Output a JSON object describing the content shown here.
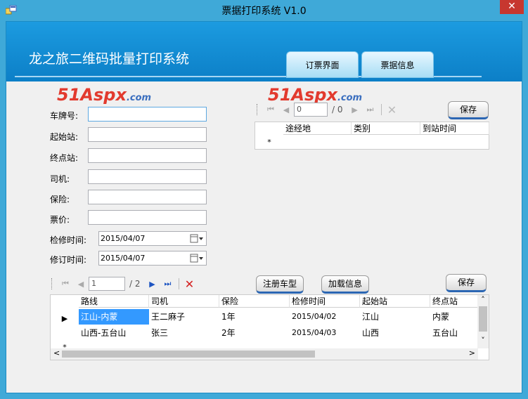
{
  "window": {
    "title": "票据打印系统 V1.0",
    "close_label": "✕"
  },
  "banner": {
    "app_title": "龙之旅二维码批量打印系统"
  },
  "tabs": [
    {
      "label": "订票界面"
    },
    {
      "label": "票据信息"
    }
  ],
  "logo": {
    "num": "51",
    "aspx": "Aspx",
    "dotcom": ".com"
  },
  "form": {
    "plate_label": "车牌号:",
    "start_label": "起始站:",
    "end_label": "终点站:",
    "driver_label": "司机:",
    "insurance_label": "保险:",
    "price_label": "票价:",
    "repair_label": "检修时间:",
    "revise_label": "修订时间:",
    "repair_date": "2015/04/07",
    "revise_date": "2015/04/07"
  },
  "top_nav": {
    "position": "0",
    "total": "/ 0"
  },
  "top_save": "保存",
  "top_grid": {
    "columns": [
      "途经地",
      "类别",
      "到站时间"
    ],
    "new_row_marker": "*"
  },
  "bottom_nav": {
    "position": "1",
    "total": "/ 2"
  },
  "buttons": {
    "register": "注册车型",
    "load": "加载信息",
    "save": "保存"
  },
  "bottom_grid": {
    "columns": [
      "路线",
      "司机",
      "保险",
      "检修时间",
      "起始站",
      "终点站"
    ],
    "rows": [
      {
        "route": "江山-内蒙",
        "driver": "王二麻子",
        "insurance": "1年",
        "repair": "2015/04/02",
        "start": "江山",
        "end": "内蒙"
      },
      {
        "route": "山西-五台山",
        "driver": "张三",
        "insurance": "2年",
        "repair": "2015/04/03",
        "start": "山西",
        "end": "五台山"
      }
    ],
    "current_marker": "▶",
    "new_row_marker": "*"
  },
  "icons": {
    "first": "⏮",
    "prev": "◀",
    "next": "▶",
    "last": "⏭",
    "delete": "✕",
    "scroll_up": "˄",
    "scroll_down": "˅",
    "scroll_left": "<",
    "scroll_right": ">"
  }
}
